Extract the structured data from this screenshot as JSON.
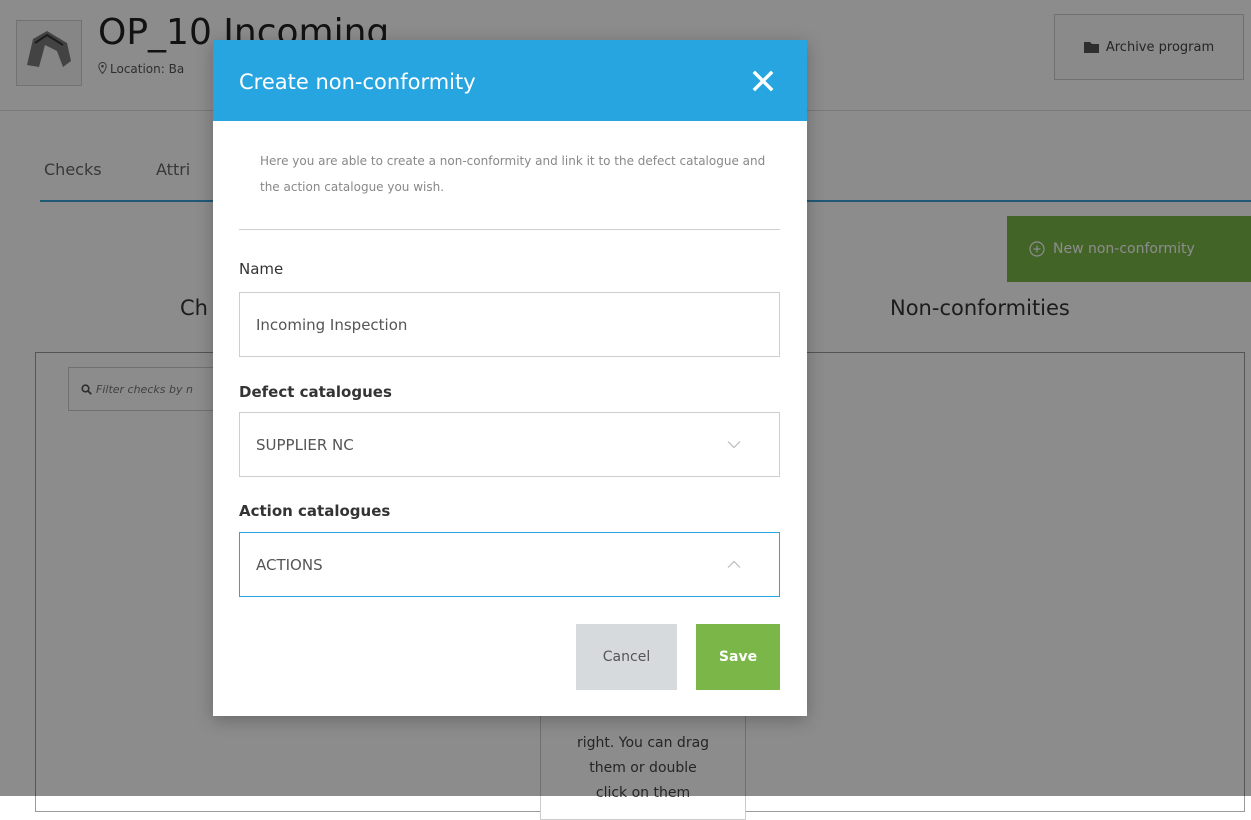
{
  "header": {
    "title": "OP_10 Incoming",
    "location": "Location: Ba",
    "archive_label": "Archive program"
  },
  "tabs": [
    {
      "label": "Checks"
    },
    {
      "label": "Attri"
    }
  ],
  "new_nc_label": "New non-conformity",
  "columns": {
    "left_title": "Ch",
    "right_title": "Non-conformities"
  },
  "filter": {
    "placeholder": "Filter checks by n"
  },
  "drop_hint": [
    "right. You can drag",
    "them or double",
    "click on them"
  ],
  "modal": {
    "title": "Create non-conformity",
    "description": "Here you are able to create a non-conformity and link it to the defect catalogue and the action catalogue you wish.",
    "name_label": "Name",
    "name_value": "Incoming Inspection",
    "defect_label": "Defect catalogues",
    "defect_value": "SUPPLIER NC",
    "action_label": "Action catalogues",
    "action_value": "ACTIONS",
    "cancel_label": "Cancel",
    "save_label": "Save"
  },
  "colors": {
    "accent_blue": "#27a5e0",
    "tab_underline": "#3ba2d6",
    "green": "#7ab648",
    "overlay": "rgba(0,0,0,0.45)"
  }
}
